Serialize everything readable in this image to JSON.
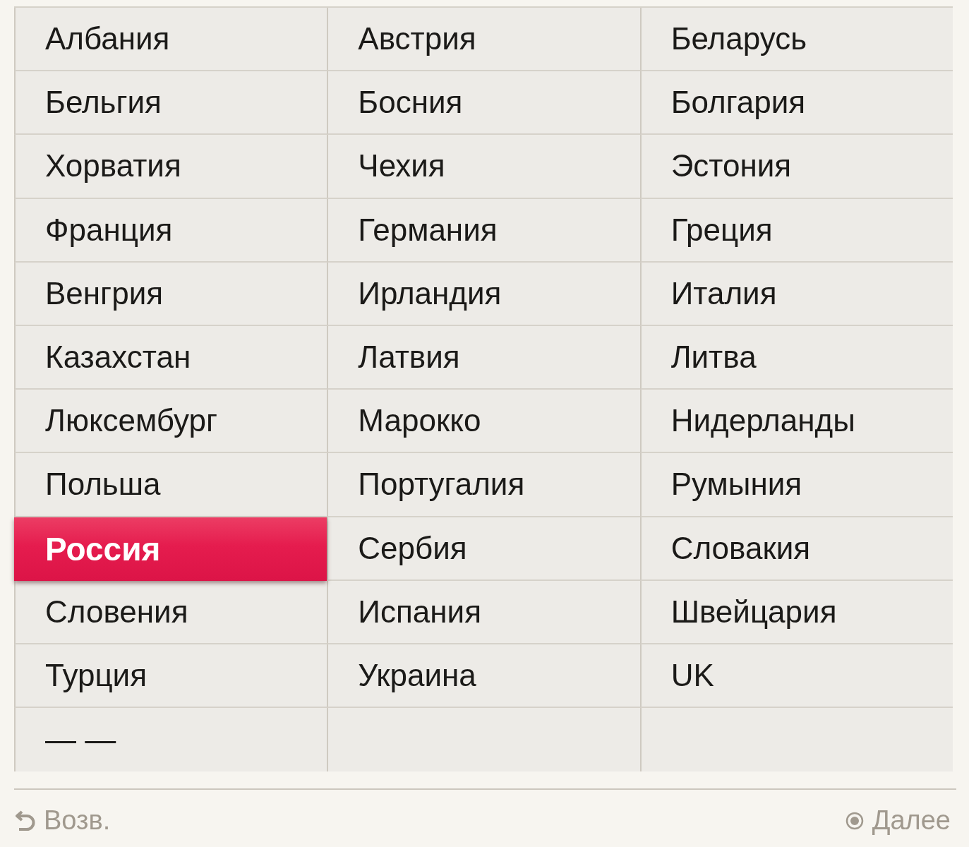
{
  "country_grid": {
    "cells": [
      {
        "label": "Албания",
        "selected": false
      },
      {
        "label": "Австрия",
        "selected": false
      },
      {
        "label": "Беларусь",
        "selected": false
      },
      {
        "label": "Бельгия",
        "selected": false
      },
      {
        "label": "Босния",
        "selected": false
      },
      {
        "label": "Болгария",
        "selected": false
      },
      {
        "label": "Хорватия",
        "selected": false
      },
      {
        "label": "Чехия",
        "selected": false
      },
      {
        "label": "Эстония",
        "selected": false
      },
      {
        "label": "Франция",
        "selected": false
      },
      {
        "label": "Германия",
        "selected": false
      },
      {
        "label": "Греция",
        "selected": false
      },
      {
        "label": "Венгрия",
        "selected": false
      },
      {
        "label": "Ирландия",
        "selected": false
      },
      {
        "label": "Италия",
        "selected": false
      },
      {
        "label": "Казахстан",
        "selected": false
      },
      {
        "label": "Латвия",
        "selected": false
      },
      {
        "label": "Литва",
        "selected": false
      },
      {
        "label": "Люксембург",
        "selected": false
      },
      {
        "label": "Марокко",
        "selected": false
      },
      {
        "label": "Нидерланды",
        "selected": false
      },
      {
        "label": "Польша",
        "selected": false
      },
      {
        "label": "Португалия",
        "selected": false
      },
      {
        "label": "Румыния",
        "selected": false
      },
      {
        "label": "Россия",
        "selected": true
      },
      {
        "label": "Сербия",
        "selected": false
      },
      {
        "label": "Словакия",
        "selected": false
      },
      {
        "label": "Словения",
        "selected": false
      },
      {
        "label": "Испания",
        "selected": false
      },
      {
        "label": "Швейцария",
        "selected": false
      },
      {
        "label": "Турция",
        "selected": false
      },
      {
        "label": "Украина",
        "selected": false
      },
      {
        "label": "UK",
        "selected": false
      },
      {
        "label": "— —",
        "selected": false
      }
    ]
  },
  "footer": {
    "back": {
      "label": "Возв."
    },
    "next": {
      "label": "Далее"
    }
  }
}
